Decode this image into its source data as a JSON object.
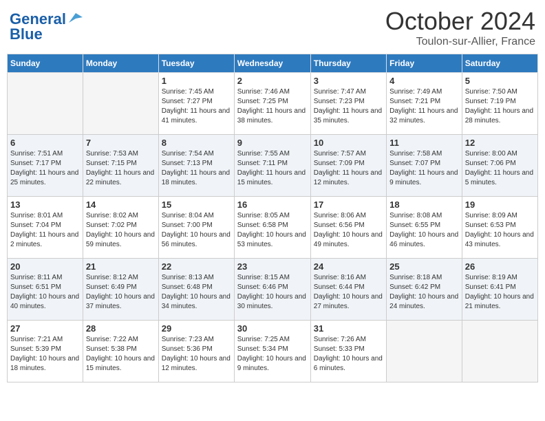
{
  "header": {
    "logo_line1": "General",
    "logo_line2": "Blue",
    "month": "October 2024",
    "location": "Toulon-sur-Allier, France"
  },
  "weekdays": [
    "Sunday",
    "Monday",
    "Tuesday",
    "Wednesday",
    "Thursday",
    "Friday",
    "Saturday"
  ],
  "weeks": [
    [
      {
        "day": "",
        "sunrise": "",
        "sunset": "",
        "daylight": ""
      },
      {
        "day": "",
        "sunrise": "",
        "sunset": "",
        "daylight": ""
      },
      {
        "day": "1",
        "sunrise": "Sunrise: 7:45 AM",
        "sunset": "Sunset: 7:27 PM",
        "daylight": "Daylight: 11 hours and 41 minutes."
      },
      {
        "day": "2",
        "sunrise": "Sunrise: 7:46 AM",
        "sunset": "Sunset: 7:25 PM",
        "daylight": "Daylight: 11 hours and 38 minutes."
      },
      {
        "day": "3",
        "sunrise": "Sunrise: 7:47 AM",
        "sunset": "Sunset: 7:23 PM",
        "daylight": "Daylight: 11 hours and 35 minutes."
      },
      {
        "day": "4",
        "sunrise": "Sunrise: 7:49 AM",
        "sunset": "Sunset: 7:21 PM",
        "daylight": "Daylight: 11 hours and 32 minutes."
      },
      {
        "day": "5",
        "sunrise": "Sunrise: 7:50 AM",
        "sunset": "Sunset: 7:19 PM",
        "daylight": "Daylight: 11 hours and 28 minutes."
      }
    ],
    [
      {
        "day": "6",
        "sunrise": "Sunrise: 7:51 AM",
        "sunset": "Sunset: 7:17 PM",
        "daylight": "Daylight: 11 hours and 25 minutes."
      },
      {
        "day": "7",
        "sunrise": "Sunrise: 7:53 AM",
        "sunset": "Sunset: 7:15 PM",
        "daylight": "Daylight: 11 hours and 22 minutes."
      },
      {
        "day": "8",
        "sunrise": "Sunrise: 7:54 AM",
        "sunset": "Sunset: 7:13 PM",
        "daylight": "Daylight: 11 hours and 18 minutes."
      },
      {
        "day": "9",
        "sunrise": "Sunrise: 7:55 AM",
        "sunset": "Sunset: 7:11 PM",
        "daylight": "Daylight: 11 hours and 15 minutes."
      },
      {
        "day": "10",
        "sunrise": "Sunrise: 7:57 AM",
        "sunset": "Sunset: 7:09 PM",
        "daylight": "Daylight: 11 hours and 12 minutes."
      },
      {
        "day": "11",
        "sunrise": "Sunrise: 7:58 AM",
        "sunset": "Sunset: 7:07 PM",
        "daylight": "Daylight: 11 hours and 9 minutes."
      },
      {
        "day": "12",
        "sunrise": "Sunrise: 8:00 AM",
        "sunset": "Sunset: 7:06 PM",
        "daylight": "Daylight: 11 hours and 5 minutes."
      }
    ],
    [
      {
        "day": "13",
        "sunrise": "Sunrise: 8:01 AM",
        "sunset": "Sunset: 7:04 PM",
        "daylight": "Daylight: 11 hours and 2 minutes."
      },
      {
        "day": "14",
        "sunrise": "Sunrise: 8:02 AM",
        "sunset": "Sunset: 7:02 PM",
        "daylight": "Daylight: 10 hours and 59 minutes."
      },
      {
        "day": "15",
        "sunrise": "Sunrise: 8:04 AM",
        "sunset": "Sunset: 7:00 PM",
        "daylight": "Daylight: 10 hours and 56 minutes."
      },
      {
        "day": "16",
        "sunrise": "Sunrise: 8:05 AM",
        "sunset": "Sunset: 6:58 PM",
        "daylight": "Daylight: 10 hours and 53 minutes."
      },
      {
        "day": "17",
        "sunrise": "Sunrise: 8:06 AM",
        "sunset": "Sunset: 6:56 PM",
        "daylight": "Daylight: 10 hours and 49 minutes."
      },
      {
        "day": "18",
        "sunrise": "Sunrise: 8:08 AM",
        "sunset": "Sunset: 6:55 PM",
        "daylight": "Daylight: 10 hours and 46 minutes."
      },
      {
        "day": "19",
        "sunrise": "Sunrise: 8:09 AM",
        "sunset": "Sunset: 6:53 PM",
        "daylight": "Daylight: 10 hours and 43 minutes."
      }
    ],
    [
      {
        "day": "20",
        "sunrise": "Sunrise: 8:11 AM",
        "sunset": "Sunset: 6:51 PM",
        "daylight": "Daylight: 10 hours and 40 minutes."
      },
      {
        "day": "21",
        "sunrise": "Sunrise: 8:12 AM",
        "sunset": "Sunset: 6:49 PM",
        "daylight": "Daylight: 10 hours and 37 minutes."
      },
      {
        "day": "22",
        "sunrise": "Sunrise: 8:13 AM",
        "sunset": "Sunset: 6:48 PM",
        "daylight": "Daylight: 10 hours and 34 minutes."
      },
      {
        "day": "23",
        "sunrise": "Sunrise: 8:15 AM",
        "sunset": "Sunset: 6:46 PM",
        "daylight": "Daylight: 10 hours and 30 minutes."
      },
      {
        "day": "24",
        "sunrise": "Sunrise: 8:16 AM",
        "sunset": "Sunset: 6:44 PM",
        "daylight": "Daylight: 10 hours and 27 minutes."
      },
      {
        "day": "25",
        "sunrise": "Sunrise: 8:18 AM",
        "sunset": "Sunset: 6:42 PM",
        "daylight": "Daylight: 10 hours and 24 minutes."
      },
      {
        "day": "26",
        "sunrise": "Sunrise: 8:19 AM",
        "sunset": "Sunset: 6:41 PM",
        "daylight": "Daylight: 10 hours and 21 minutes."
      }
    ],
    [
      {
        "day": "27",
        "sunrise": "Sunrise: 7:21 AM",
        "sunset": "Sunset: 5:39 PM",
        "daylight": "Daylight: 10 hours and 18 minutes."
      },
      {
        "day": "28",
        "sunrise": "Sunrise: 7:22 AM",
        "sunset": "Sunset: 5:38 PM",
        "daylight": "Daylight: 10 hours and 15 minutes."
      },
      {
        "day": "29",
        "sunrise": "Sunrise: 7:23 AM",
        "sunset": "Sunset: 5:36 PM",
        "daylight": "Daylight: 10 hours and 12 minutes."
      },
      {
        "day": "30",
        "sunrise": "Sunrise: 7:25 AM",
        "sunset": "Sunset: 5:34 PM",
        "daylight": "Daylight: 10 hours and 9 minutes."
      },
      {
        "day": "31",
        "sunrise": "Sunrise: 7:26 AM",
        "sunset": "Sunset: 5:33 PM",
        "daylight": "Daylight: 10 hours and 6 minutes."
      },
      {
        "day": "",
        "sunrise": "",
        "sunset": "",
        "daylight": ""
      },
      {
        "day": "",
        "sunrise": "",
        "sunset": "",
        "daylight": ""
      }
    ]
  ]
}
